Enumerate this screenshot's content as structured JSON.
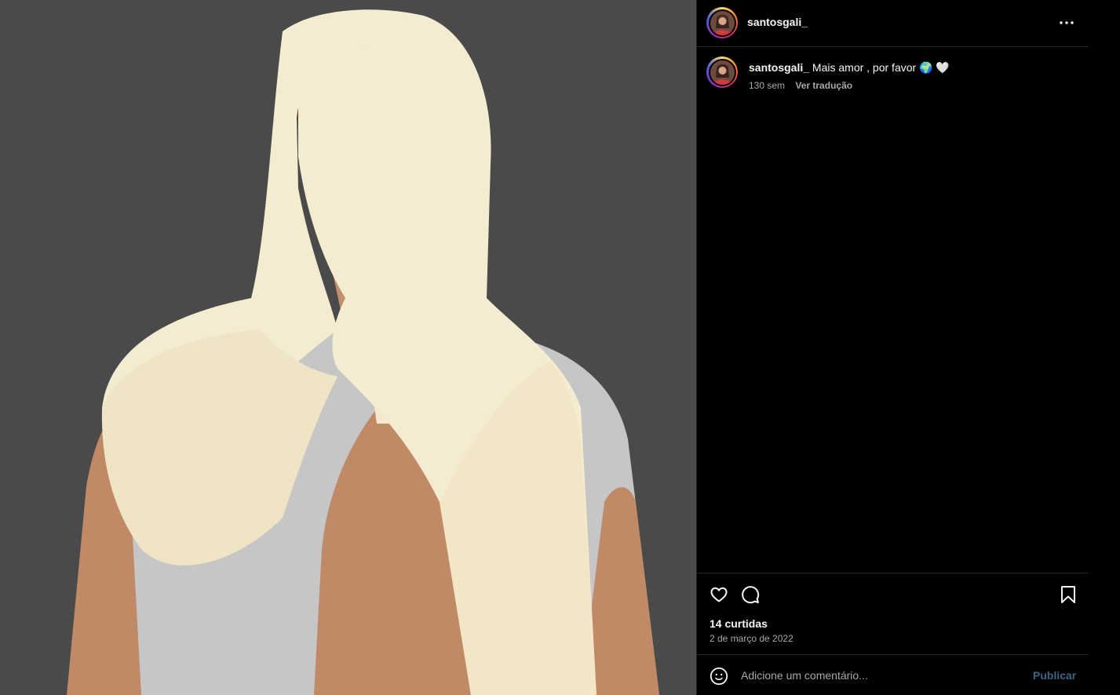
{
  "post": {
    "username": "santosgali_",
    "caption_text": "Mais amor , por favor 🌍 🤍",
    "time_ago": "130 sem",
    "translate_label": "Ver tradução",
    "likes_label": "14 curtidas",
    "date_label": "2 de março de 2022"
  },
  "comment": {
    "placeholder": "Adicione um comentário...",
    "publish_label": "Publicar"
  },
  "icons": {
    "more": "more-options-icon",
    "like": "heart-icon",
    "comment": "comment-icon",
    "save": "bookmark-icon",
    "emoji": "emoji-icon"
  },
  "colors": {
    "background": "#000000",
    "media_background": "#4a4a4a",
    "text_primary": "#f5f5f5",
    "text_secondary": "#a8a8a8",
    "publish_disabled": "#3f6383"
  }
}
